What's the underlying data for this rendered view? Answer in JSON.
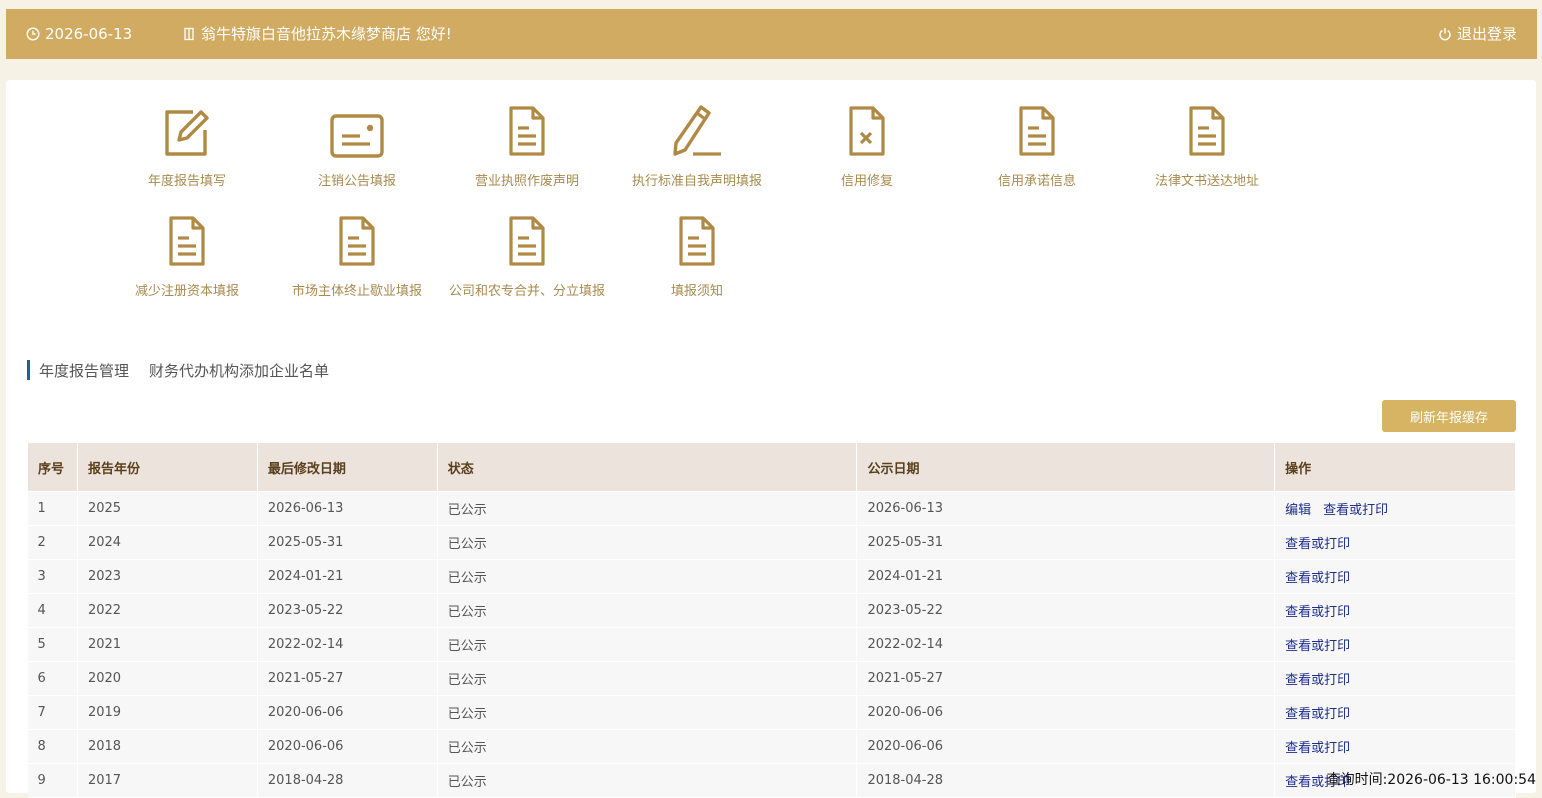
{
  "header": {
    "date": "2026-06-13",
    "greeting": "翁牛特旗白音他拉苏木缘梦商店 您好!",
    "logout": "退出登录"
  },
  "quick_links": [
    {
      "label": "年度报告填写",
      "icon": "edit-icon"
    },
    {
      "label": "注销公告填报",
      "icon": "id-card-icon"
    },
    {
      "label": "营业执照作废声明",
      "icon": "document-icon"
    },
    {
      "label": "执行标准自我声明填报",
      "icon": "pencil-icon"
    },
    {
      "label": "信用修复",
      "icon": "document-x-icon"
    },
    {
      "label": "信用承诺信息",
      "icon": "document-icon"
    },
    {
      "label": "法律文书送达地址",
      "icon": "document-icon"
    },
    {
      "label": "减少注册资本填报",
      "icon": "document-icon"
    },
    {
      "label": "市场主体终止歇业填报",
      "icon": "document-icon"
    },
    {
      "label": "公司和农专合并、分立填报",
      "icon": "document-icon"
    },
    {
      "label": "填报须知",
      "icon": "document-icon"
    }
  ],
  "section_tabs": [
    "年度报告管理",
    "财务代办机构添加企业名单"
  ],
  "refresh_button": "刷新年报缓存",
  "table": {
    "headers": [
      "序号",
      "报告年份",
      "最后修改日期",
      "状态",
      "公示日期",
      "操作"
    ],
    "rows": [
      {
        "no": "1",
        "year": "2025",
        "modified": "2026-06-13",
        "status": "已公示",
        "published": "2026-06-13",
        "actions": [
          "编辑",
          "查看或打印"
        ]
      },
      {
        "no": "2",
        "year": "2024",
        "modified": "2025-05-31",
        "status": "已公示",
        "published": "2025-05-31",
        "actions": [
          "查看或打印"
        ]
      },
      {
        "no": "3",
        "year": "2023",
        "modified": "2024-01-21",
        "status": "已公示",
        "published": "2024-01-21",
        "actions": [
          "查看或打印"
        ]
      },
      {
        "no": "4",
        "year": "2022",
        "modified": "2023-05-22",
        "status": "已公示",
        "published": "2023-05-22",
        "actions": [
          "查看或打印"
        ]
      },
      {
        "no": "5",
        "year": "2021",
        "modified": "2022-02-14",
        "status": "已公示",
        "published": "2022-02-14",
        "actions": [
          "查看或打印"
        ]
      },
      {
        "no": "6",
        "year": "2020",
        "modified": "2021-05-27",
        "status": "已公示",
        "published": "2021-05-27",
        "actions": [
          "查看或打印"
        ]
      },
      {
        "no": "7",
        "year": "2019",
        "modified": "2020-06-06",
        "status": "已公示",
        "published": "2020-06-06",
        "actions": [
          "查看或打印"
        ]
      },
      {
        "no": "8",
        "year": "2018",
        "modified": "2020-06-06",
        "status": "已公示",
        "published": "2020-06-06",
        "actions": [
          "查看或打印"
        ]
      },
      {
        "no": "9",
        "year": "2017",
        "modified": "2018-04-28",
        "status": "已公示",
        "published": "2018-04-28",
        "actions": [
          "查看或打印"
        ]
      }
    ]
  },
  "timestamp_overlay": "查询时间:2026-06-13 16:00:54",
  "colors": {
    "header_bg": "#d0ab61",
    "icon": "#b08a45",
    "link": "#1e2e8c",
    "accent_bar": "#1a5fa8"
  }
}
